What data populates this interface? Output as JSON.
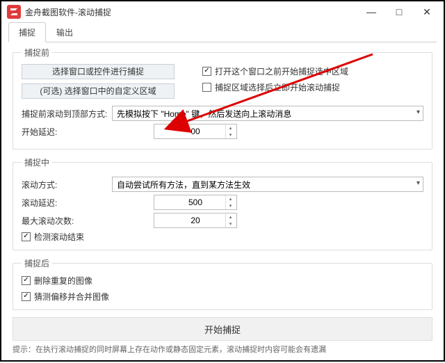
{
  "window": {
    "title": "金舟截图软件-滚动捕捉",
    "min": "—",
    "max": "□",
    "close": "✕"
  },
  "tabs": {
    "capture": "捕捉",
    "output": "输出"
  },
  "before": {
    "legend": "捕捉前",
    "select_ctrl": "选择窗口或控件进行捕捉",
    "select_region": "(可选) 选择窗口中的自定义区域",
    "check_select_region": "打开这个窗口之前开始捕捉选中区域",
    "check_scroll_after_select": "捕捉区域选择后立即开始滚动捕捉",
    "top_method_label": "捕捉前滚动到顶部方式:",
    "top_method_value": "先模拟按下 \"Home\" 键，然后发送向上滚动消息",
    "start_delay_label": "开始延迟:",
    "start_delay_value": "00"
  },
  "during": {
    "legend": "捕捉中",
    "scroll_method_label": "滚动方式:",
    "scroll_method_value": "自动尝试所有方法，直到某方法生效",
    "scroll_delay_label": "滚动延迟:",
    "scroll_delay_value": "500",
    "max_scroll_label": "最大滚动次数:",
    "max_scroll_value": "20",
    "detect_end": "检测滚动结束"
  },
  "after": {
    "legend": "捕捉后",
    "remove_dup": "删除重复的图像",
    "guess_merge": "猜测偏移并合并图像"
  },
  "start_btn": "开始捕捉",
  "hint": "提示：在执行滚动捕捉的同时屏幕上存在动作或静态固定元素，滚动捕捉时内容可能会有遗漏"
}
